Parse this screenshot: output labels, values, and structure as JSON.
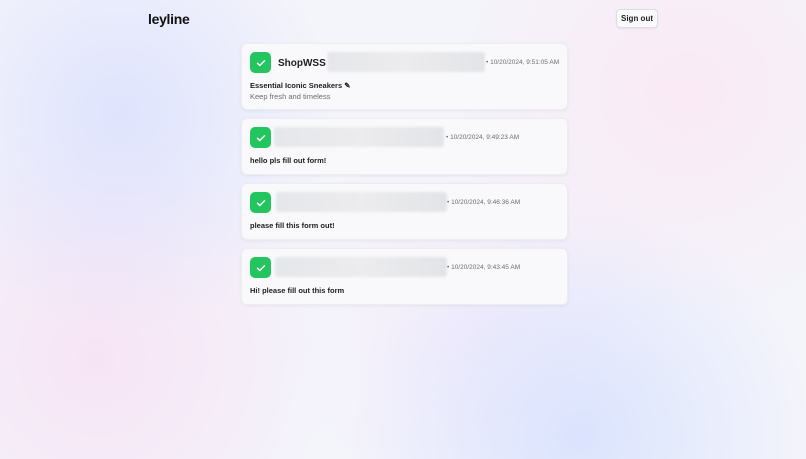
{
  "header": {
    "logo": "leyline",
    "signout_label": "Sign out"
  },
  "messages": [
    {
      "sender": "ShopWSS",
      "timestamp": "• 10/20/2024, 9:51:05 AM",
      "title": "Essential Iconic Sneakers ✎",
      "subtitle": "Keep fresh and timeless"
    },
    {
      "timestamp": "• 10/20/2024, 9:49:23 AM",
      "title": "hello pls fill out form!"
    },
    {
      "timestamp": "• 10/20/2024, 9:46:36 AM",
      "title": "please fill this form out!"
    },
    {
      "timestamp": "• 10/20/2024, 9:43:45 AM",
      "title": "Hi! please fill out this form"
    }
  ],
  "colors": {
    "check": "#22c55e",
    "background": "#f4f4fb"
  },
  "icons": {
    "status": "checkmark-icon"
  }
}
